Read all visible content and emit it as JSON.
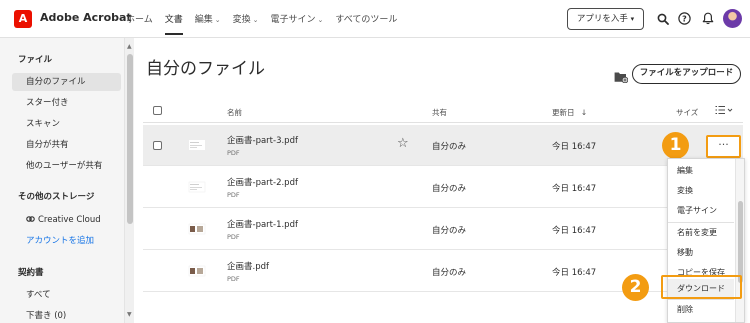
{
  "header": {
    "logo_glyph": "A",
    "app_name": "Adobe Acrobat",
    "nav": [
      {
        "label": "ホーム",
        "dropdown": false,
        "active": false
      },
      {
        "label": "文書",
        "dropdown": false,
        "active": true
      },
      {
        "label": "編集",
        "dropdown": true,
        "active": false
      },
      {
        "label": "変換",
        "dropdown": true,
        "active": false
      },
      {
        "label": "電子サイン",
        "dropdown": true,
        "active": false
      },
      {
        "label": "すべてのツール",
        "dropdown": false,
        "active": false
      }
    ],
    "get_apps_label": "アプリを入手",
    "icons": [
      "search-icon",
      "help-icon",
      "bell-icon",
      "avatar"
    ],
    "accent_color": "#eb1000"
  },
  "sidebar": {
    "files_heading": "ファイル",
    "files_items": [
      {
        "label": "自分のファイル",
        "selected": true
      },
      {
        "label": "スター付き",
        "selected": false
      },
      {
        "label": "スキャン",
        "selected": false
      },
      {
        "label": "自分が共有",
        "selected": false
      },
      {
        "label": "他のユーザーが共有",
        "selected": false
      }
    ],
    "storage_heading": "その他のストレージ",
    "storage_items": [
      {
        "label": "Creative Cloud",
        "icon": "creative-cloud-icon"
      },
      {
        "label": "アカウントを追加",
        "link": true
      }
    ],
    "agreements_heading": "契約書",
    "agreements_items": [
      {
        "label": "すべて"
      },
      {
        "label": "下書き (0)"
      }
    ]
  },
  "main": {
    "title": "自分のファイル",
    "upload_label": "ファイルをアップロード",
    "columns": {
      "name": "名前",
      "shared": "共有",
      "modified": "更新日",
      "size": "サイズ"
    },
    "files": [
      {
        "name": "企画書-part-3.pdf",
        "type": "PDF",
        "shared": "自分のみ",
        "modified": "今日 16:47",
        "highlighted": true
      },
      {
        "name": "企画書-part-2.pdf",
        "type": "PDF",
        "shared": "自分のみ",
        "modified": "今日 16:47",
        "highlighted": false
      },
      {
        "name": "企画書-part-1.pdf",
        "type": "PDF",
        "shared": "自分のみ",
        "modified": "今日 16:47",
        "highlighted": false
      },
      {
        "name": "企画書.pdf",
        "type": "PDF",
        "shared": "自分のみ",
        "modified": "今日 16:47",
        "highlighted": false
      }
    ]
  },
  "more_button_label": "···",
  "context_menu": {
    "items": [
      "編集",
      "変換",
      "電子サイン",
      "名前を変更",
      "移動",
      "コピーを保存",
      "ダウンロード",
      "削除"
    ],
    "highlighted_item": "ダウンロード"
  },
  "annotations": {
    "badge_1": "1",
    "badge_2": "2",
    "color": "#f39c12"
  }
}
